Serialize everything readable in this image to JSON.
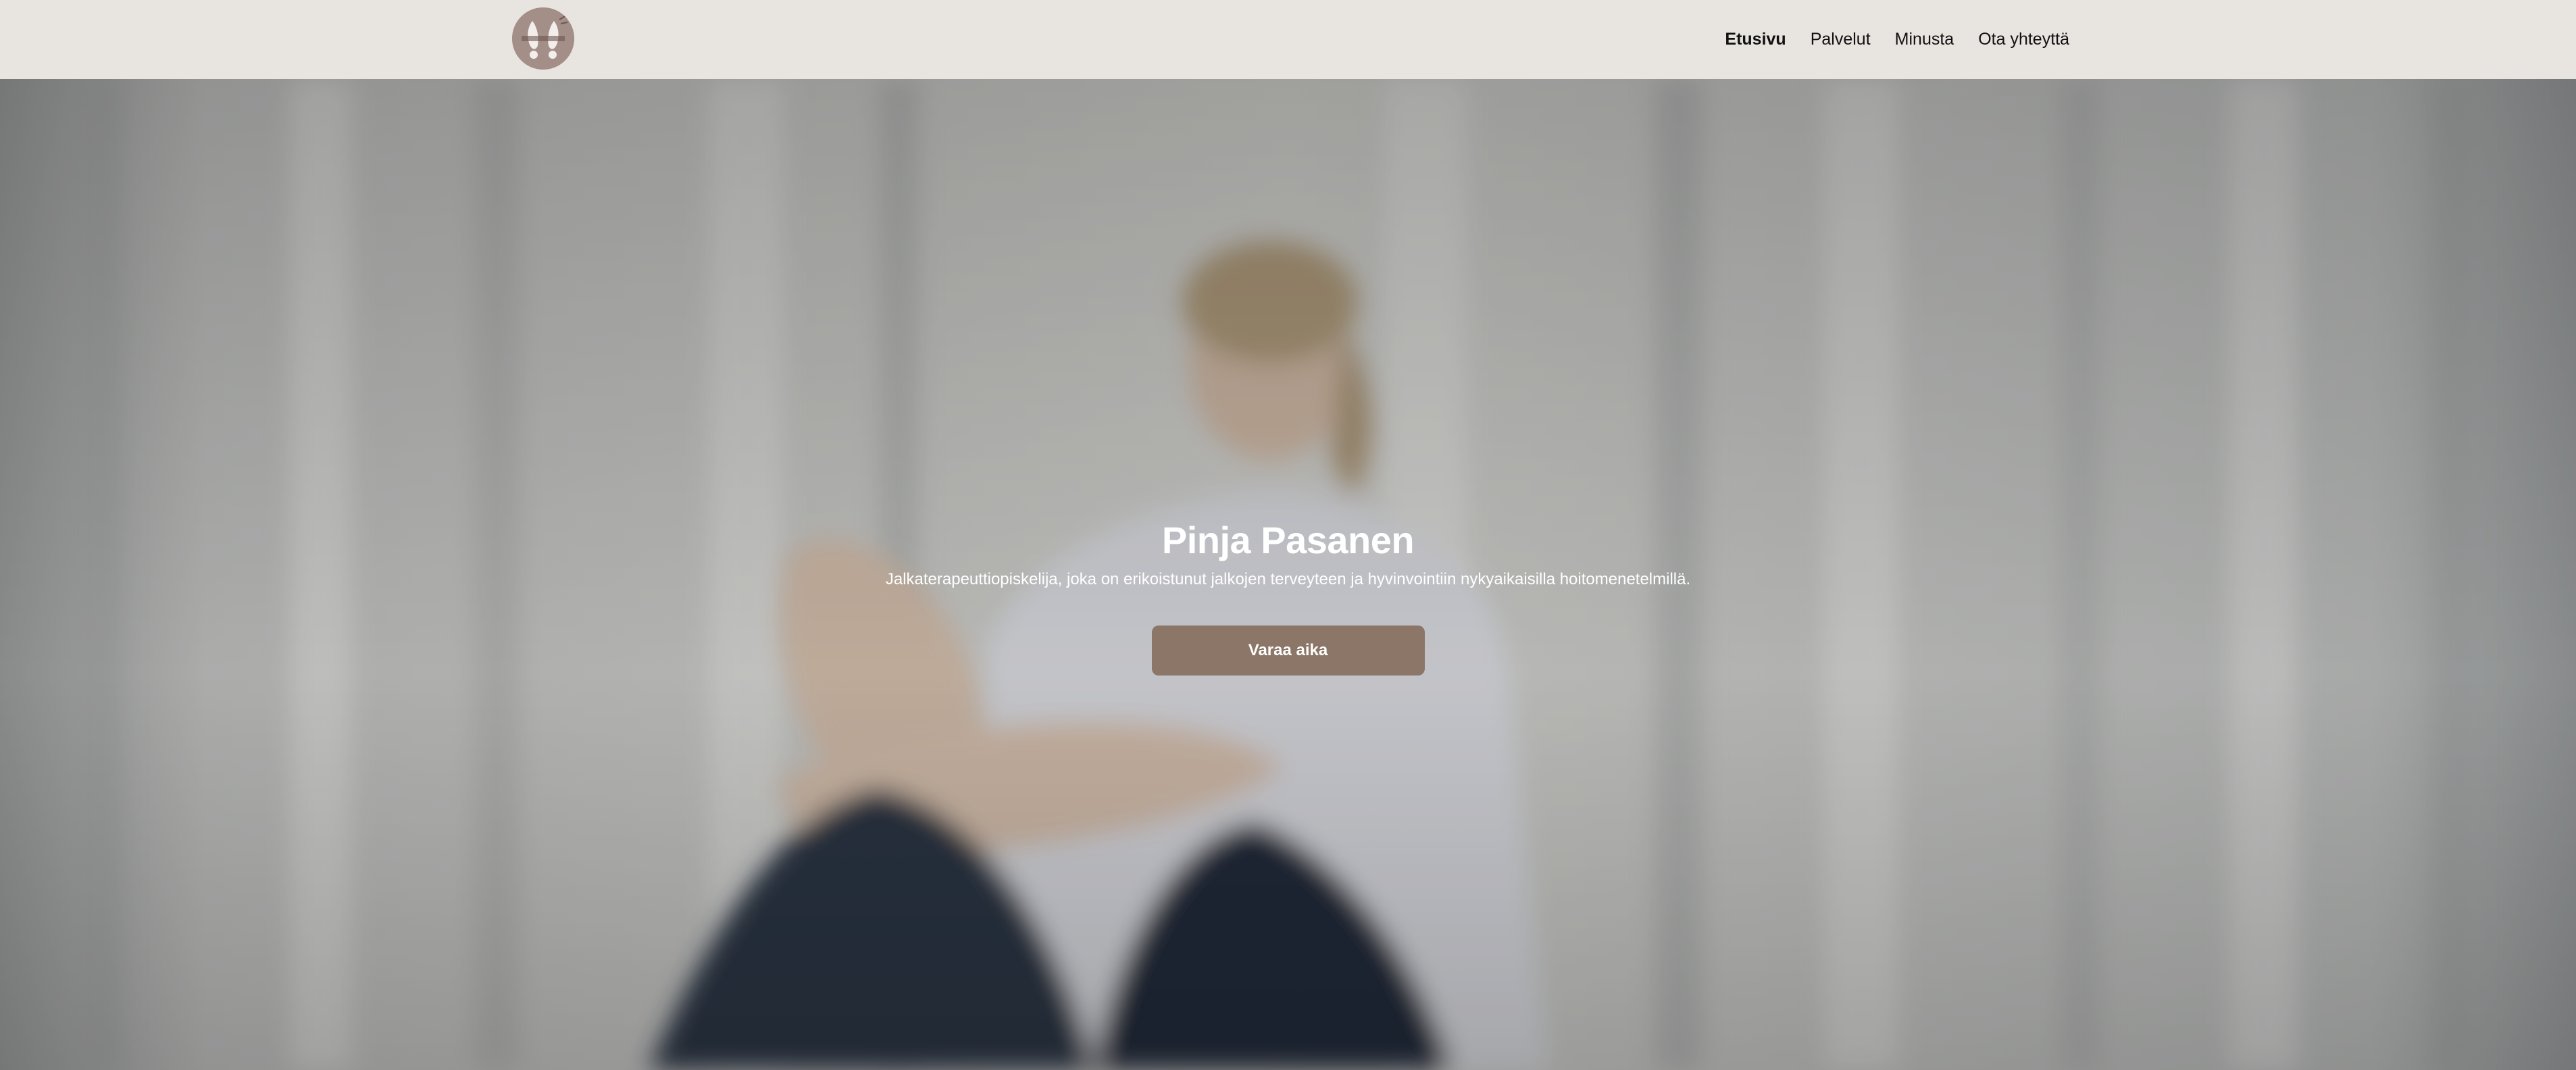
{
  "header": {
    "logo_icon": "feet-logo-icon",
    "nav": [
      {
        "label": "Etusivu",
        "active": true
      },
      {
        "label": "Palvelut",
        "active": false
      },
      {
        "label": "Minusta",
        "active": false
      },
      {
        "label": "Ota yhteyttä",
        "active": false
      }
    ]
  },
  "hero": {
    "title": "Pinja Pasanen",
    "subtitle": "Jalkaterapeuttiopiskelija, joka on erikoistunut jalkojen terveyteen ja hyvinvointiin nykyaikaisilla hoitomenetelmillä.",
    "cta_label": "Varaa aika"
  },
  "colors": {
    "header_bg": "#e8e4e0",
    "cta_bg": "#8c7668",
    "logo_bg": "#a38e88"
  }
}
